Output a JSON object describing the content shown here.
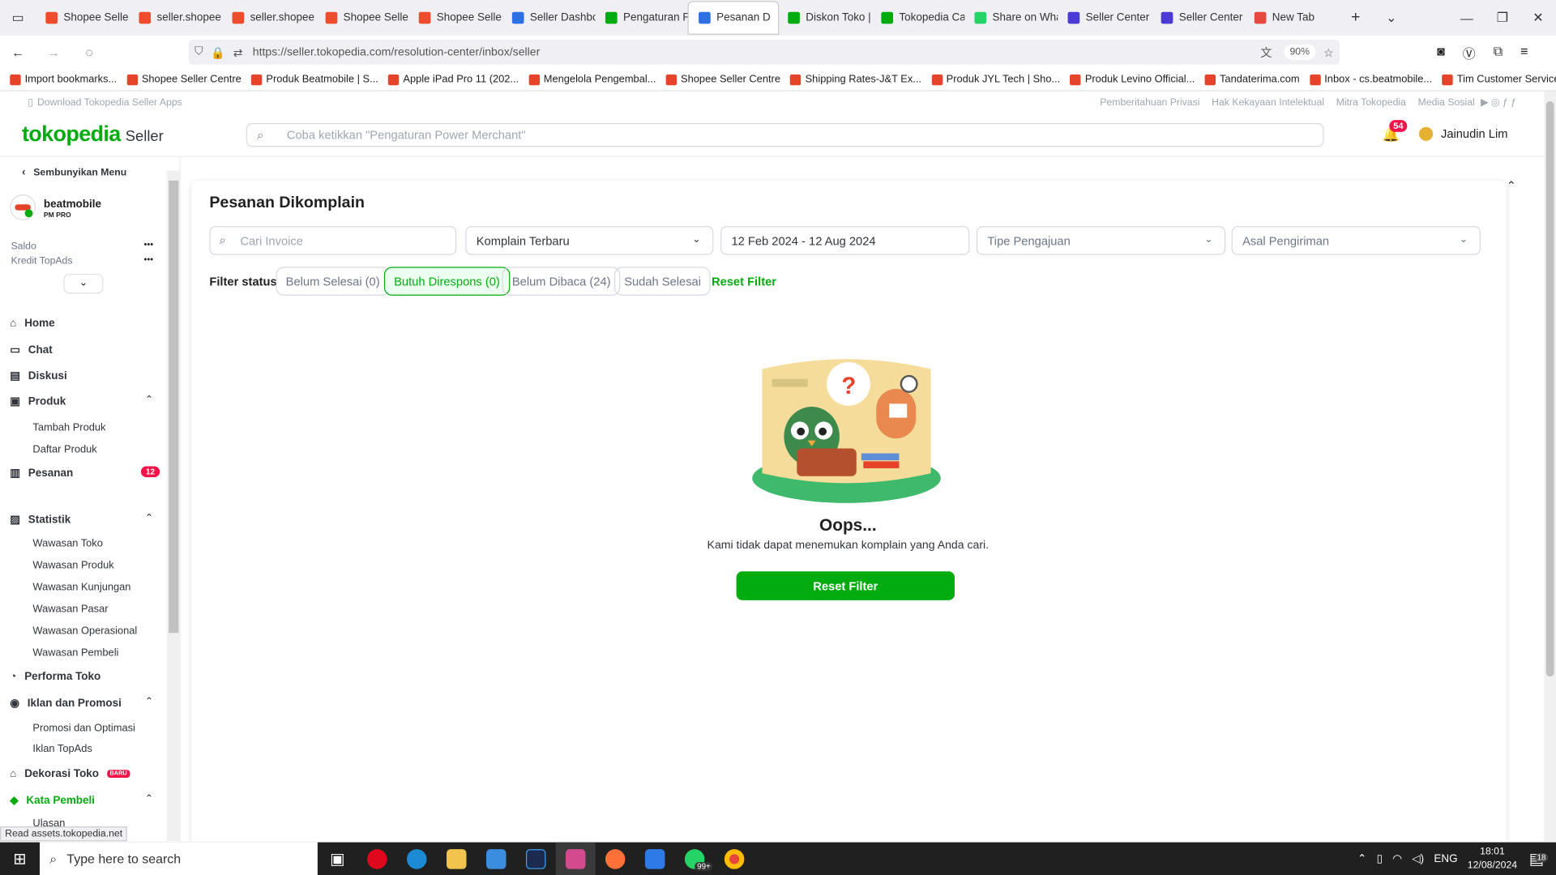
{
  "browser": {
    "tabs": [
      {
        "label": "Shopee Seller",
        "color": "#ee4d2d"
      },
      {
        "label": "seller.shopee",
        "color": "#ee4d2d"
      },
      {
        "label": "seller.shopee",
        "color": "#ee4d2d"
      },
      {
        "label": "Shopee Seller",
        "color": "#ee4d2d"
      },
      {
        "label": "Shopee Seller",
        "color": "#ee4d2d"
      },
      {
        "label": "Seller Dashbo",
        "color": "#2f6fe4"
      },
      {
        "label": "Pengaturan P",
        "color": "#03ac0e"
      },
      {
        "label": "Pesanan D",
        "color": "#2f6fe4"
      },
      {
        "label": "Diskon Toko |",
        "color": "#03ac0e"
      },
      {
        "label": "Tokopedia Ca",
        "color": "#03ac0e"
      },
      {
        "label": "Share on Wha",
        "color": "#25d366"
      },
      {
        "label": "Seller Center",
        "color": "#4b3ad6"
      },
      {
        "label": "Seller Center",
        "color": "#4b3ad6"
      },
      {
        "label": "New Tab",
        "color": "#e64a3f"
      }
    ],
    "url": "https://seller.tokopedia.com/resolution-center/inbox/seller",
    "zoom": "90%",
    "bookmarks": [
      "Import bookmarks...",
      "Shopee Seller Centre",
      "Produk Beatmobile | S...",
      "Apple iPad Pro 11 (202...",
      "Mengelola Pengembal...",
      "Shopee Seller Centre",
      "Shipping Rates-J&T Ex...",
      "Produk JYL Tech | Sho...",
      "Produk Levino Official...",
      "Tandaterima.com",
      "Inbox - cs.beatmobile...",
      "Tim Customer Service ..."
    ],
    "status_text": "Read assets.tokopedia.net"
  },
  "topstrip": {
    "download": "Download Tokopedia Seller Apps",
    "links": [
      "Pemberitahuan Privasi",
      "Hak Kekayaan Intelektual",
      "Mitra Tokopedia",
      "Media Sosial"
    ]
  },
  "header": {
    "logo": "tokopedia",
    "logo_sub": "Seller",
    "search_placeholder": "Coba ketikkan \"Pengaturan Power Merchant\"",
    "notif_count": "54",
    "user": "Jainudin Lim"
  },
  "sidebar": {
    "hide_menu": "Sembunyikan Menu",
    "shop_name": "beatmobile",
    "shop_tier": "PM PRO",
    "saldo": "Saldo",
    "kredit": "Kredit TopAds",
    "masked": "•••",
    "home": "Home",
    "chat": "Chat",
    "diskusi": "Diskusi",
    "produk": "Produk",
    "tambah_produk": "Tambah Produk",
    "daftar_produk": "Daftar Produk",
    "pesanan": "Pesanan",
    "pesanan_badge": "12",
    "statistik": "Statistik",
    "stat_items": [
      "Wawasan Toko",
      "Wawasan Produk",
      "Wawasan Kunjungan",
      "Wawasan Pasar",
      "Wawasan Operasional",
      "Wawasan Pembeli"
    ],
    "performa": "Performa Toko",
    "iklan": "Iklan dan Promosi",
    "iklan_items": [
      "Promosi dan Optimasi",
      "Iklan TopAds"
    ],
    "dekorasi": "Dekorasi Toko",
    "dekorasi_badge": "BARU",
    "kata_pembeli": "Kata Pembeli",
    "ulasan": "Ulasan"
  },
  "main": {
    "title": "Pesanan Dikomplain",
    "invoice_placeholder": "Cari Invoice",
    "sort": "Komplain Terbaru",
    "date_range": "12 Feb 2024 - 12 Aug 2024",
    "tipe": "Tipe Pengajuan",
    "asal": "Asal Pengiriman",
    "filter_label": "Filter status",
    "chips": [
      "Belum Selesai (0)",
      "Butuh Direspons (0)",
      "Belum Dibaca (24)",
      "Sudah Selesai"
    ],
    "reset_link": "Reset Filter",
    "empty_title": "Oops...",
    "empty_desc": "Kami tidak dapat menemukan komplain yang Anda cari.",
    "reset_button": "Reset Filter"
  },
  "taskbar": {
    "search_placeholder": "Type here to search",
    "lang": "ENG",
    "time": "18:01",
    "date": "12/08/2024",
    "notif": "18",
    "whatsapp_badge": "99+"
  }
}
